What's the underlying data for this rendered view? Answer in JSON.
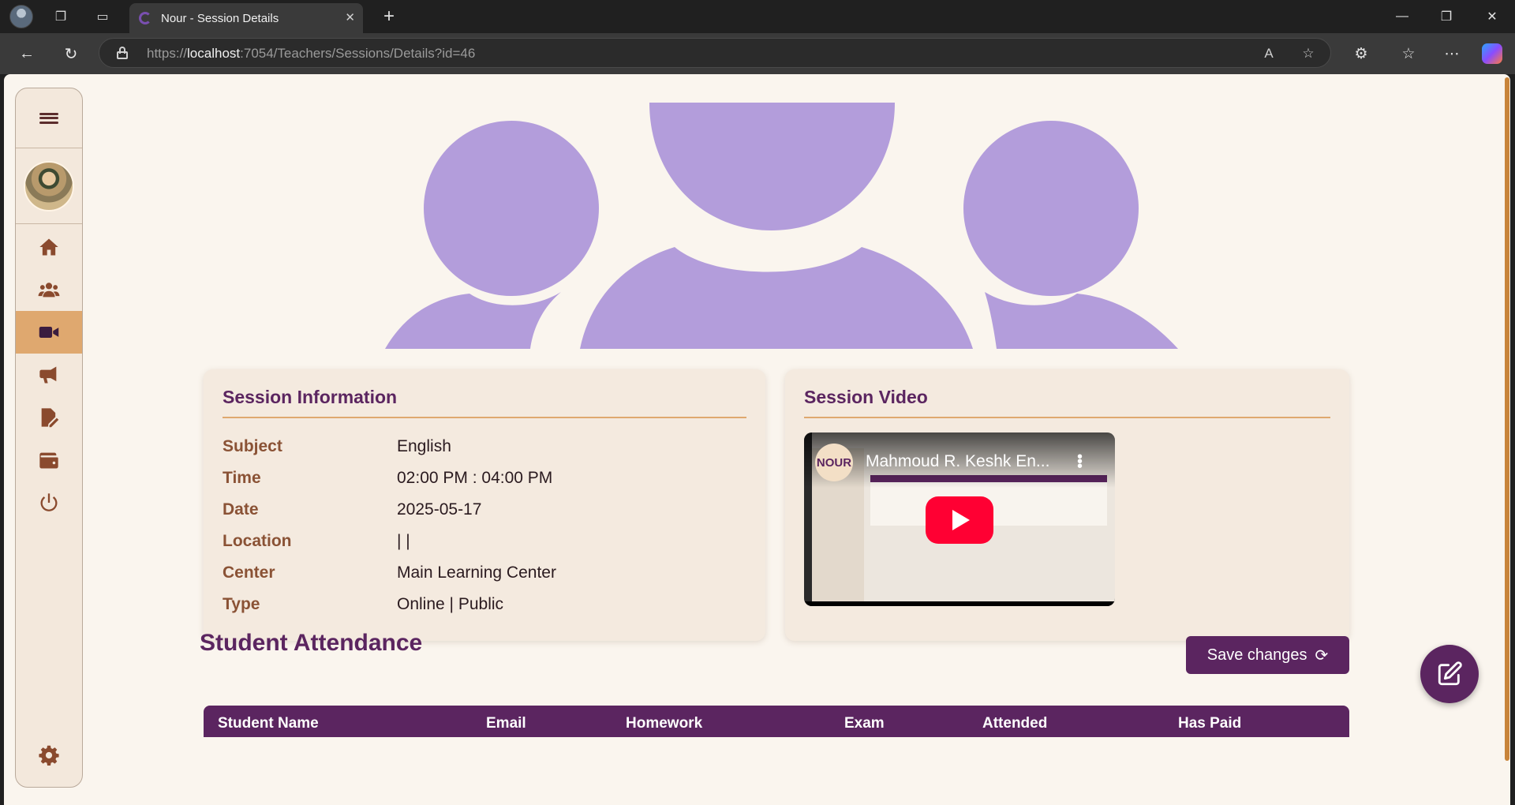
{
  "browser": {
    "tab_title": "Nour - Session Details",
    "url_scheme": "https://",
    "url_host": "localhost",
    "url_rest": ":7054/Teachers/Sessions/Details?id=46"
  },
  "sidebar": {
    "items": [
      {
        "icon": "home-icon",
        "active": false
      },
      {
        "icon": "users-icon",
        "active": false
      },
      {
        "icon": "video-icon",
        "active": true
      },
      {
        "icon": "megaphone-icon",
        "active": false
      },
      {
        "icon": "file-edit-icon",
        "active": false
      },
      {
        "icon": "wallet-icon",
        "active": false
      },
      {
        "icon": "power-icon",
        "active": false
      },
      {
        "icon": "gear-icon",
        "active": false
      }
    ]
  },
  "session_info": {
    "title": "Session Information",
    "rows": [
      {
        "label": "Subject",
        "value": "English"
      },
      {
        "label": "Time",
        "value": "02:00 PM : 04:00 PM"
      },
      {
        "label": "Date",
        "value": "2025-05-17"
      },
      {
        "label": "Location",
        "value": "| |"
      },
      {
        "label": "Center",
        "value": "Main Learning Center"
      },
      {
        "label": "Type",
        "value": "Online | Public"
      }
    ]
  },
  "session_video": {
    "title": "Session Video",
    "channel_logo": "NOUR",
    "video_title": "Mahmoud R. Keshk En..."
  },
  "attendance": {
    "title": "Student Attendance",
    "save_label": "Save changes",
    "columns": [
      "Student Name",
      "Email",
      "Homework",
      "Exam",
      "Attended",
      "Has Paid"
    ]
  },
  "colors": {
    "brand": "#5b2560",
    "accent": "#dfa86f",
    "label": "#8a5235",
    "banner": "#b39ddb",
    "background": "#faf5ee"
  }
}
